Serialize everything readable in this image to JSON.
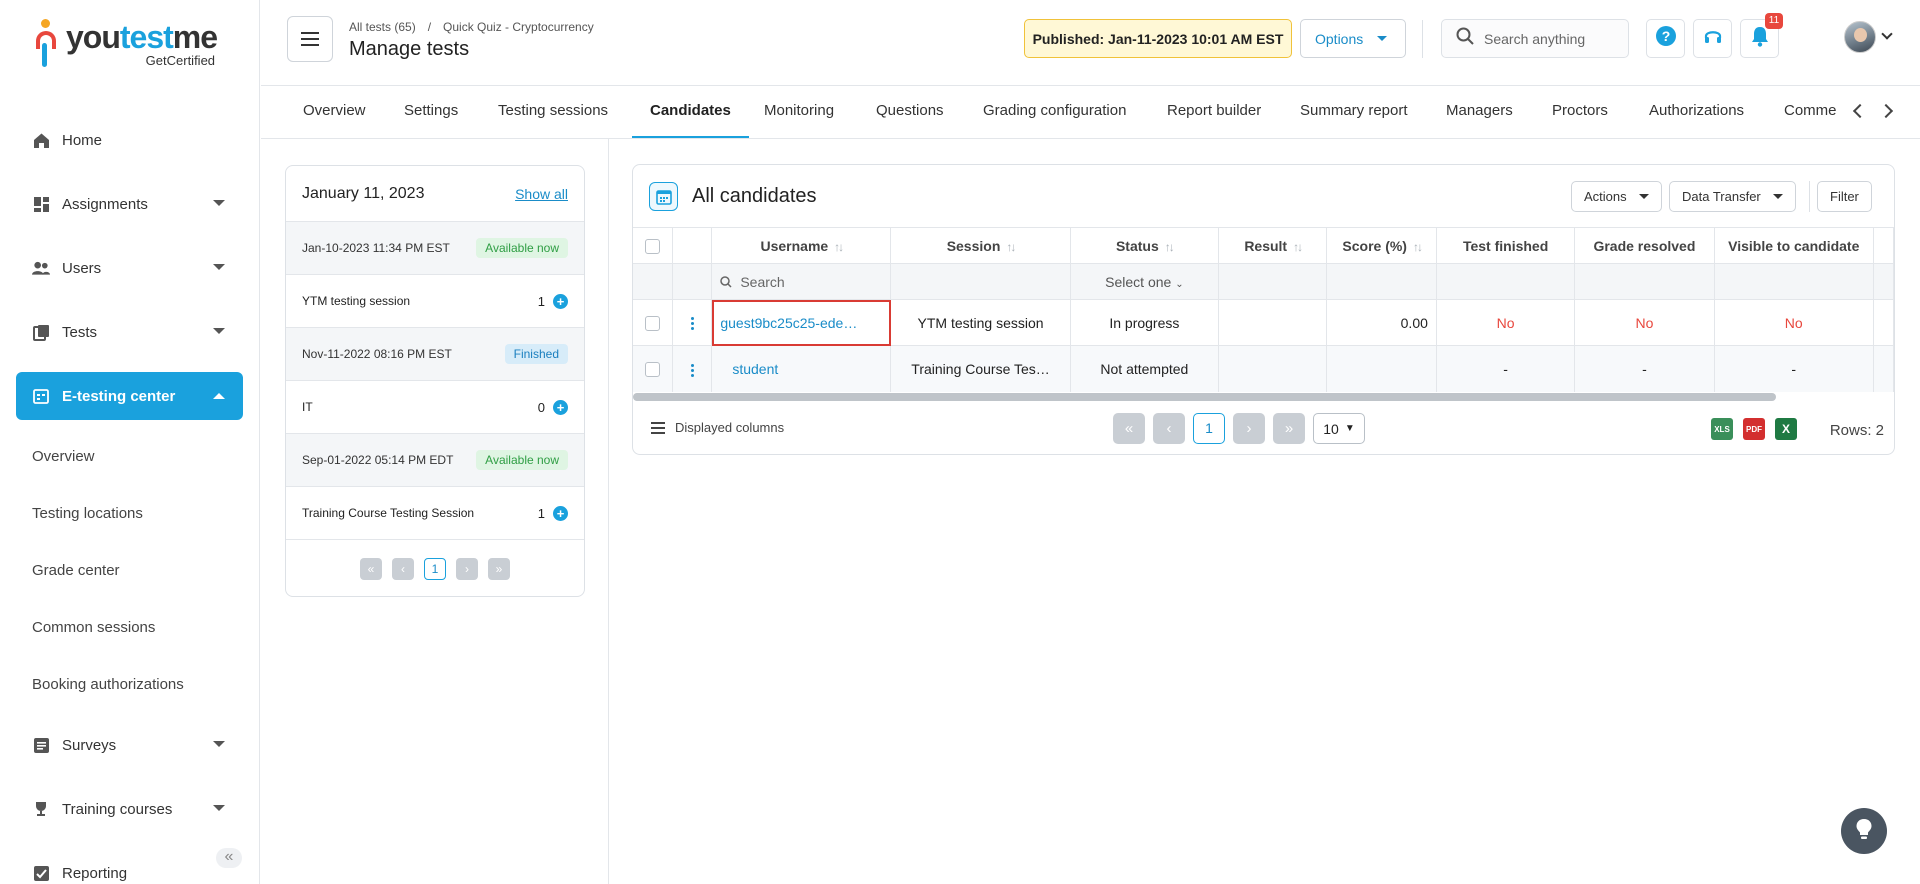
{
  "logo": {
    "word_you": "you",
    "word_test": "test",
    "word_me": "me",
    "sub": "GetCertified"
  },
  "sidebar": {
    "items": [
      {
        "label": "Home",
        "icon": "home-icon"
      },
      {
        "label": "Assignments",
        "icon": "assignments-icon"
      },
      {
        "label": "Users",
        "icon": "users-icon"
      },
      {
        "label": "Tests",
        "icon": "tests-icon"
      },
      {
        "label": "E-testing center",
        "icon": "e-testing-icon"
      }
    ],
    "sub_items": [
      {
        "label": "Overview"
      },
      {
        "label": "Testing locations"
      },
      {
        "label": "Grade center"
      },
      {
        "label": "Common sessions"
      },
      {
        "label": "Booking authorizations"
      }
    ],
    "more_items": [
      {
        "label": "Surveys",
        "icon": "surveys-icon"
      },
      {
        "label": "Training courses",
        "icon": "trophy-icon"
      },
      {
        "label": "Reporting",
        "icon": "reporting-icon"
      }
    ]
  },
  "header": {
    "crumb1": "All tests (65)",
    "crumb_sep": "/",
    "crumb2": "Quick Quiz - Cryptocurrency",
    "title": "Manage tests",
    "published": "Published: Jan-11-2023 10:01 AM EST",
    "options": "Options",
    "search_placeholder": "Search anything",
    "notifications": "11"
  },
  "tabs": [
    {
      "label": "Overview"
    },
    {
      "label": "Settings"
    },
    {
      "label": "Testing sessions"
    },
    {
      "label": "Candidates"
    },
    {
      "label": "Monitoring"
    },
    {
      "label": "Questions"
    },
    {
      "label": "Grading configuration"
    },
    {
      "label": "Report builder"
    },
    {
      "label": "Summary report"
    },
    {
      "label": "Managers"
    },
    {
      "label": "Proctors"
    },
    {
      "label": "Authorizations"
    },
    {
      "label": "Comme"
    }
  ],
  "sessions": {
    "date": "January 11, 2023",
    "show_all": "Show all",
    "items": [
      {
        "time": "Jan-10-2023 11:34 PM EST",
        "status": "Available now",
        "name": "YTM testing session",
        "count": "1"
      },
      {
        "time": "Nov-11-2022 08:16 PM EST",
        "status": "Finished",
        "name": "IT",
        "count": "0"
      },
      {
        "time": "Sep-01-2022 05:14 PM EDT",
        "status": "Available now",
        "name": "Training Course Testing Session",
        "count": "1"
      }
    ],
    "page": "1"
  },
  "candidates": {
    "title": "All candidates",
    "actions": "Actions",
    "data_transfer": "Data Transfer",
    "filter": "Filter",
    "columns": {
      "username": "Username",
      "session": "Session",
      "status": "Status",
      "result": "Result",
      "score": "Score (%)",
      "test_finished": "Test finished",
      "grade_resolved": "Grade resolved",
      "visible": "Visible to candidate"
    },
    "search_placeholder": "Search",
    "status_filter": "Select one",
    "rows": [
      {
        "username": "guest9bc25c25-ede…",
        "session": "YTM testing session",
        "status": "In progress",
        "result": "",
        "score": "0.00",
        "test_finished": "No",
        "grade_resolved": "No",
        "visible": "No"
      },
      {
        "username": "student",
        "session": "Training Course Tes…",
        "status": "Not attempted",
        "result": "",
        "score": "",
        "test_finished": "-",
        "grade_resolved": "-",
        "visible": "-"
      }
    ],
    "displayed_columns": "Displayed columns",
    "page": "1",
    "per_page": "10",
    "rows_count": "Rows: 2",
    "export_xls": "XLS",
    "export_pdf": "PDF",
    "export_excel": "X"
  }
}
